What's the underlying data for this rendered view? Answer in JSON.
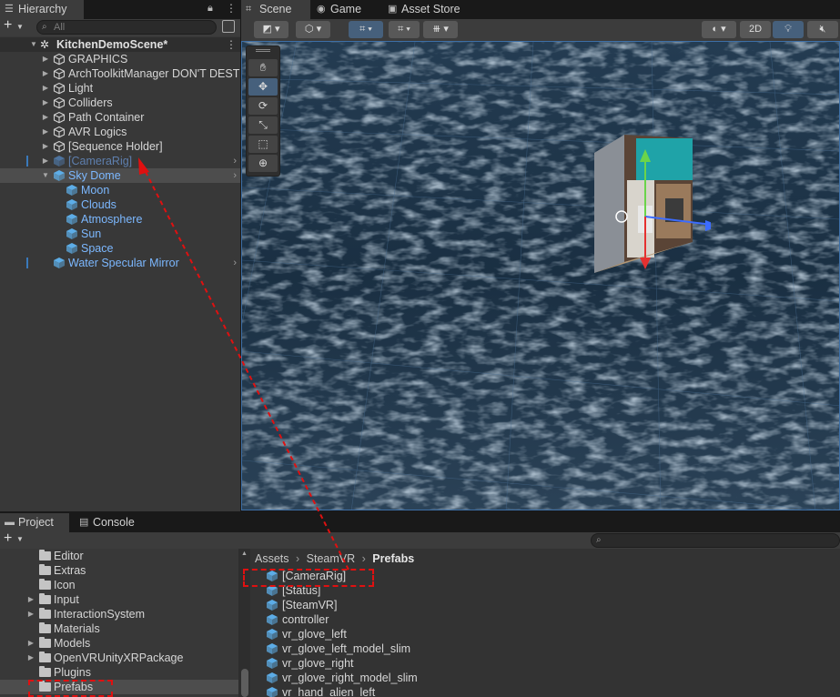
{
  "hierarchy": {
    "tab_label": "Hierarchy",
    "search_placeholder": "All",
    "add_label": "+",
    "scene_name": "KitchenDemoScene*",
    "items": [
      {
        "label": "GRAPHICS",
        "has_children": true
      },
      {
        "label": "ArchToolkitManager DON'T DEST",
        "has_children": true
      },
      {
        "label": "Light",
        "has_children": true
      },
      {
        "label": "Colliders",
        "has_children": true
      },
      {
        "label": "Path Container",
        "has_children": true
      },
      {
        "label": "AVR Logics",
        "has_children": true
      },
      {
        "label": "[Sequence Holder]",
        "has_children": true
      },
      {
        "label": "[CameraRig]",
        "has_children": true,
        "prefab": true,
        "disabled": true
      },
      {
        "label": "Sky Dome",
        "expanded": true,
        "prefab": true
      },
      {
        "label": "Moon",
        "prefab": true
      },
      {
        "label": "Clouds",
        "prefab": true
      },
      {
        "label": "Atmosphere",
        "prefab": true
      },
      {
        "label": "Sun",
        "prefab": true
      },
      {
        "label": "Space",
        "prefab": true
      },
      {
        "label": "Water Specular Mirror",
        "prefab": true
      }
    ]
  },
  "scene_view": {
    "tabs": [
      {
        "label": "Scene",
        "icon": "grid-icon",
        "active": true
      },
      {
        "label": "Game",
        "icon": "gamepad-icon",
        "active": false
      },
      {
        "label": "Asset Store",
        "icon": "store-icon",
        "active": false
      }
    ],
    "toggle_2d": "2D",
    "tool_icons": [
      "hand-icon",
      "move-icon",
      "rotate-icon",
      "scale-icon",
      "rect-icon",
      "transform-icon"
    ],
    "active_tool": "move-icon"
  },
  "project": {
    "tabs": [
      {
        "label": "Project",
        "icon": "folder-icon",
        "active": true
      },
      {
        "label": "Console",
        "icon": "console-icon",
        "active": false
      }
    ],
    "folders": [
      {
        "label": "Editor",
        "has_children": false
      },
      {
        "label": "Extras",
        "has_children": false
      },
      {
        "label": "Icon",
        "has_children": false
      },
      {
        "label": "Input",
        "has_children": true
      },
      {
        "label": "InteractionSystem",
        "has_children": true
      },
      {
        "label": "Materials",
        "has_children": false
      },
      {
        "label": "Models",
        "has_children": true
      },
      {
        "label": "OpenVRUnityXRPackage",
        "has_children": true
      },
      {
        "label": "Plugins",
        "has_children": false
      },
      {
        "label": "Prefabs",
        "has_children": false,
        "selected": true
      }
    ],
    "breadcrumb": [
      "Assets",
      "SteamVR",
      "Prefabs"
    ],
    "assets": [
      "[CameraRig]",
      "[Status]",
      "[SteamVR]",
      "controller",
      "vr_glove_left",
      "vr_glove_left_model_slim",
      "vr_glove_right",
      "vr_glove_right_model_slim",
      "vr_hand_alien_left"
    ]
  },
  "colors": {
    "annotation": "#e01010",
    "prefab_text": "#7cb8ff",
    "selection": "#46607c"
  }
}
